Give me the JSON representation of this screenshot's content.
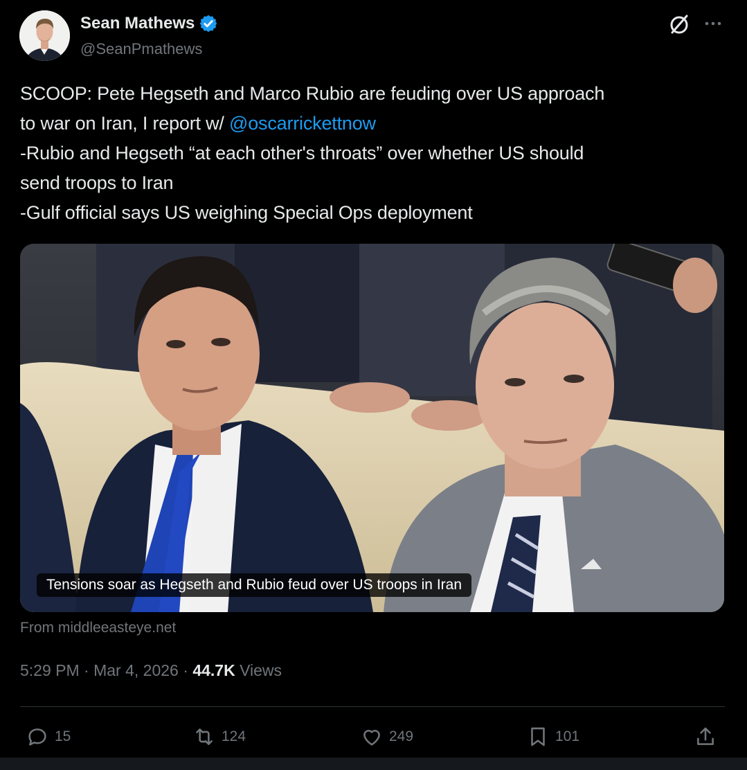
{
  "author": {
    "display_name": "Sean Mathews",
    "handle": "@SeanPmathews",
    "verified": true
  },
  "tweet": {
    "lines": [
      {
        "text": "SCOOP: Pete Hegseth and Marco Rubio are feuding over US approach"
      },
      {
        "text": "to war on Iran, I report w/ ",
        "mention": "@oscarrickettnow"
      },
      {
        "text": "-Rubio and Hegseth “at each other's throats” over whether US should"
      },
      {
        "text": "send troops to Iran"
      },
      {
        "text": "-Gulf official says US weighing Special Ops deployment"
      }
    ]
  },
  "card": {
    "caption": "Tensions soar as Hegseth and Rubio feud over US troops in Iran",
    "source": "From middleeasteye.net"
  },
  "meta": {
    "time": "5:29 PM",
    "date": "Mar 4, 2026",
    "views_count": "44.7K",
    "views_label": "Views",
    "separator": "·"
  },
  "actions": {
    "replies": "15",
    "reposts": "124",
    "likes": "249",
    "bookmarks": "101"
  },
  "icons": {
    "verified": "verified-badge-icon",
    "grok": "grok-icon",
    "more": "more-icon",
    "reply": "reply-icon",
    "repost": "repost-icon",
    "like": "heart-icon",
    "bookmark": "bookmark-icon",
    "share": "share-icon"
  },
  "colors": {
    "background": "#000000",
    "text": "#e7e9ea",
    "muted": "#71767b",
    "link": "#1d9bf0",
    "divider": "#2f3336"
  }
}
